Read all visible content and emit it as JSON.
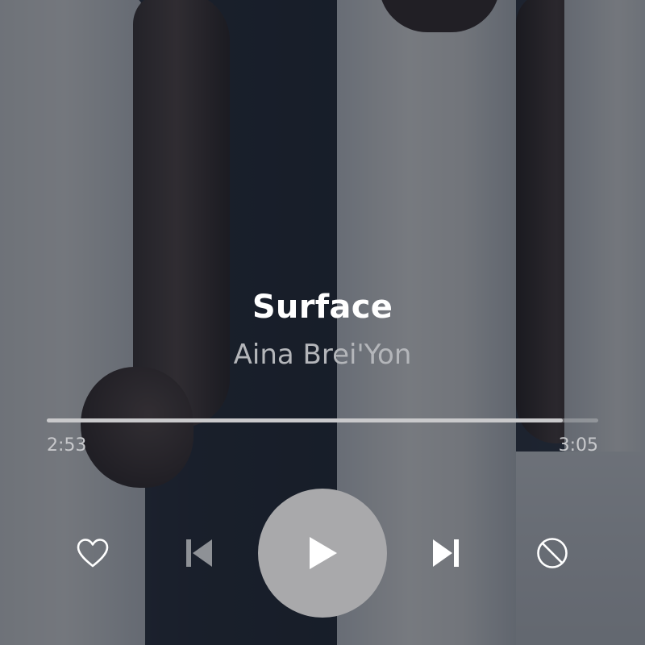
{
  "track": {
    "title": "Surface",
    "artist": "Aina Brei'Yon"
  },
  "playback": {
    "elapsed": "2:53",
    "duration": "3:05",
    "progress_fraction": 0.935
  },
  "controls": {
    "like_icon": "heart-outline-icon",
    "previous_icon": "skip-previous-icon",
    "play_icon": "play-icon",
    "next_icon": "skip-next-icon",
    "ban_icon": "ban-icon"
  },
  "colors": {
    "title": "#ffffff",
    "artist": "#b4b6ba",
    "play_button_bg": "#a9a9ab",
    "progress_fill": "#c9c9cb",
    "previous_disabled": "#8e9196"
  }
}
